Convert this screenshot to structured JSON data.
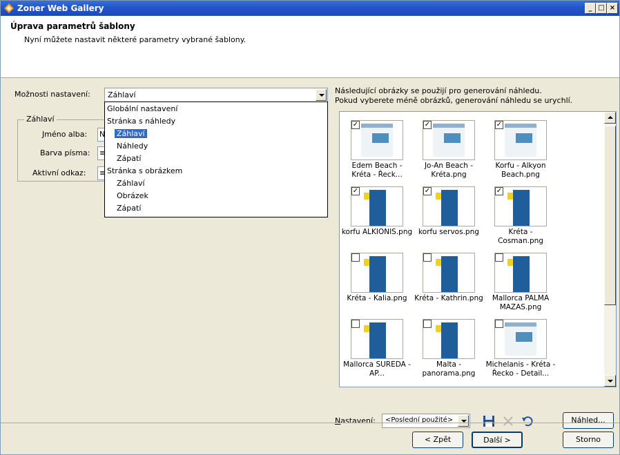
{
  "window": {
    "title": "Zoner Web Gallery",
    "minimize": "_",
    "maximize": "□",
    "close": "×"
  },
  "header": {
    "title": "Úprava parametrů šablony",
    "subtitle": "Nyní můžete nastavit některé parametry vybrané šablony."
  },
  "options": {
    "label": "Možnosti nastavení:",
    "selected": "Záhlaví"
  },
  "dropdown": {
    "items": [
      {
        "label": "Globální nastavení",
        "indent": 0,
        "selected": false
      },
      {
        "label": "Stránka s náhledy",
        "indent": 0,
        "selected": false
      },
      {
        "label": "Záhlaví",
        "indent": 1,
        "selected": true
      },
      {
        "label": "Náhledy",
        "indent": 1,
        "selected": false
      },
      {
        "label": "Zápatí",
        "indent": 1,
        "selected": false
      },
      {
        "label": "Stránka s obrázkem",
        "indent": 0,
        "selected": false
      },
      {
        "label": "Záhlaví",
        "indent": 1,
        "selected": false
      },
      {
        "label": "Obrázek",
        "indent": 1,
        "selected": false
      },
      {
        "label": "Zápatí",
        "indent": 1,
        "selected": false
      }
    ]
  },
  "group": {
    "label": "Záhlaví",
    "fields": [
      {
        "label": "Jméno alba:",
        "value": "N"
      },
      {
        "label": "Barva písma:",
        "value": "≡"
      },
      {
        "label": "Aktivní odkaz:",
        "value": "≡"
      }
    ]
  },
  "preview_info": {
    "line1": "Následující obrázky se použijí pro generování náhledu.",
    "line2": "Pokud vyberete méně obrázků, generování náhledu se urychlí."
  },
  "thumbnails": [
    {
      "caption": "Edem Beach - Kréta - Řeck...",
      "checked": true,
      "style": "light"
    },
    {
      "caption": "Jo-An Beach - Kréta.png",
      "checked": true,
      "style": "light"
    },
    {
      "caption": "Korfu - Alkyon Beach.png",
      "checked": true,
      "style": "light"
    },
    {
      "caption": "korfu ALKIONIS.png",
      "checked": true,
      "style": "blue"
    },
    {
      "caption": "korfu servos.png",
      "checked": true,
      "style": "blue"
    },
    {
      "caption": "Kréta - Cosman.png",
      "checked": true,
      "style": "blue"
    },
    {
      "caption": "Kréta - Kalia.png",
      "checked": false,
      "style": "blue"
    },
    {
      "caption": "Kréta - Kathrin.png",
      "checked": false,
      "style": "blue"
    },
    {
      "caption": "Mallorca PALMA MAZAS.png",
      "checked": false,
      "style": "blue"
    },
    {
      "caption": "Mallorca SUREDA - AP...",
      "checked": false,
      "style": "blue"
    },
    {
      "caption": "Malta - panorama.png",
      "checked": false,
      "style": "blue"
    },
    {
      "caption": "Michelanis - Kréta - Řecko - Detail...",
      "checked": false,
      "style": "light"
    }
  ],
  "settings": {
    "label": "Nastavení:",
    "value": "<Poslední použité>",
    "preview_button": "Náhled..."
  },
  "nav": {
    "back": "< Zpět",
    "next": "Další >",
    "cancel": "Storno"
  },
  "colors": {
    "accent": "#316ac5",
    "titlebar": "#2457c9",
    "face": "#ece9d8"
  }
}
